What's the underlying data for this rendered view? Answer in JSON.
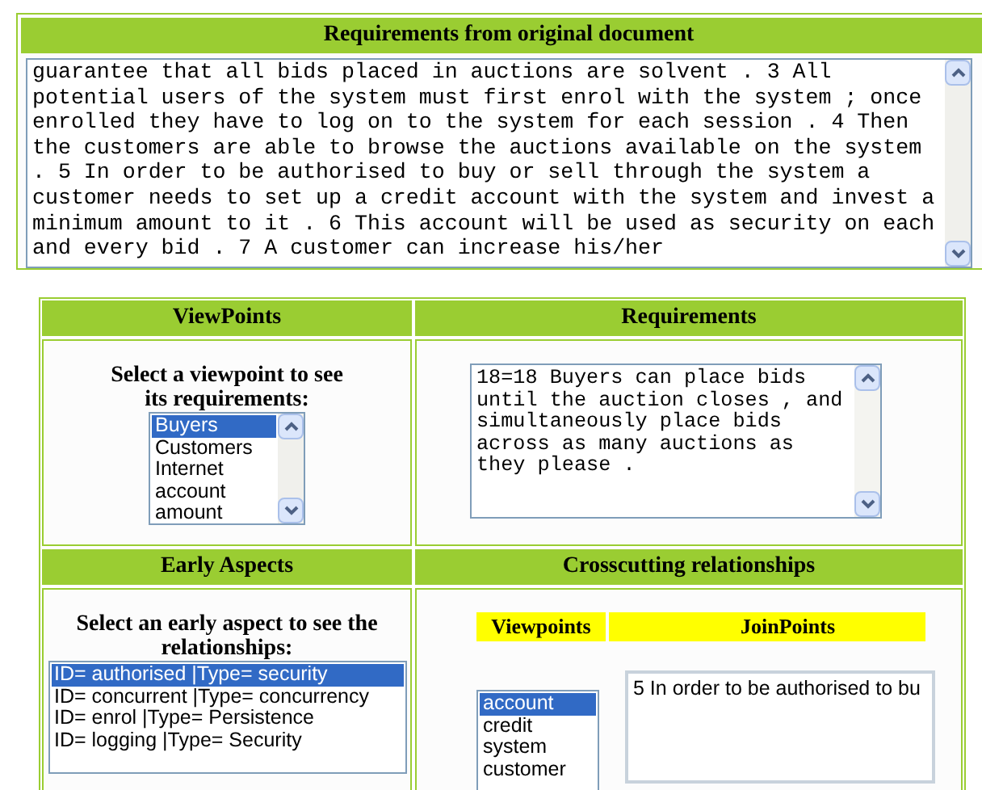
{
  "original_document": {
    "title": "Requirements from original document",
    "text": "guarantee that all bids placed in auctions are solvent . 3 All potential users of the system must first enrol with the system ; once enrolled they have to log on to the system for each session . 4 Then the customers are able to browse the auctions available on the system . 5 In order to be authorised to buy or sell through the system a customer needs to set up a credit account with the system and invest a minimum amount to it . 6 This account will be used as security on each and every bid . 7 A customer can increase his/her"
  },
  "viewpoints": {
    "title": "ViewPoints",
    "prompt": "Select a viewpoint to see its requirements:",
    "items": [
      {
        "label": "Buyers",
        "selected": true
      },
      {
        "label": "Customers",
        "selected": false
      },
      {
        "label": "Internet",
        "selected": false
      },
      {
        "label": "account",
        "selected": false
      },
      {
        "label": "amount",
        "selected": false
      }
    ]
  },
  "requirements": {
    "title": "Requirements",
    "text": "18=18 Buyers can place bids until the auction closes , and simultaneously place bids across as many auctions as they please ."
  },
  "early_aspects": {
    "title": "Early Aspects",
    "prompt": "Select an early aspect to see the relationships:",
    "items": [
      {
        "label": "ID= authorised |Type= security",
        "selected": true
      },
      {
        "label": "ID= concurrent |Type= concurrency",
        "selected": false
      },
      {
        "label": "ID= enrol |Type= Persistence",
        "selected": false
      },
      {
        "label": "ID= logging |Type= Security",
        "selected": false
      }
    ]
  },
  "crosscutting": {
    "title": "Crosscutting relationships",
    "viewpoints_heading": "Viewpoints",
    "joinpoints_heading": "JoinPoints",
    "viewpoints": [
      {
        "label": "account",
        "selected": true
      },
      {
        "label": "credit",
        "selected": false
      },
      {
        "label": "system",
        "selected": false
      },
      {
        "label": "customer",
        "selected": false
      }
    ],
    "joinpoints_text": "5 In order to be authorised to bu"
  }
}
